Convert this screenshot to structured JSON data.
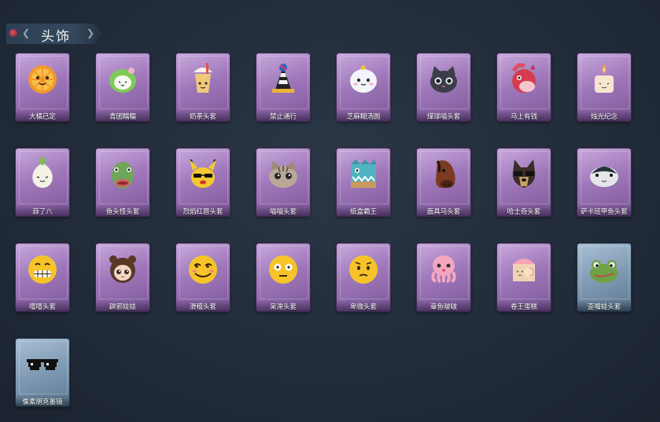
{
  "section": {
    "title": "头饰"
  },
  "items": [
    {
      "label": "大橘已定",
      "icon": "orange-icon",
      "rarity": "purple"
    },
    {
      "label": "青团糯糯",
      "icon": "green-rice-ball-icon",
      "rarity": "purple"
    },
    {
      "label": "奶茶头套",
      "icon": "milk-tea-icon",
      "rarity": "purple"
    },
    {
      "label": "禁止通行",
      "icon": "traffic-cone-icon",
      "rarity": "purple"
    },
    {
      "label": "芝麻糊汤圆",
      "icon": "rice-dumpling-icon",
      "rarity": "purple"
    },
    {
      "label": "煤球喵头套",
      "icon": "black-cat-icon",
      "rarity": "purple"
    },
    {
      "label": "马上有钱",
      "icon": "red-horse-icon",
      "rarity": "purple"
    },
    {
      "label": "烛光纪念",
      "icon": "candle-icon",
      "rarity": "purple"
    },
    {
      "label": "蒜了八",
      "icon": "garlic-icon",
      "rarity": "purple"
    },
    {
      "label": "鱼头怪头套",
      "icon": "fish-head-icon",
      "rarity": "purple"
    },
    {
      "label": "烈焰红唇头套",
      "icon": "yellow-mascot-icon",
      "rarity": "purple"
    },
    {
      "label": "喵喵头套",
      "icon": "tabby-cat-icon",
      "rarity": "purple"
    },
    {
      "label": "纸盒霸王",
      "icon": "box-dinosaur-icon",
      "rarity": "purple"
    },
    {
      "label": "面具马头套",
      "icon": "horse-mask-icon",
      "rarity": "purple"
    },
    {
      "label": "哈士奇头套",
      "icon": "dog-sunglasses-icon",
      "rarity": "purple"
    },
    {
      "label": "萨卡班甲鱼头套",
      "icon": "armored-fish-icon",
      "rarity": "purple"
    },
    {
      "label": "嘻嘻头套",
      "icon": "grin-emoji-icon",
      "rarity": "purple"
    },
    {
      "label": "辟邪娃娃",
      "icon": "doll-icon",
      "rarity": "purple"
    },
    {
      "label": "滑稽头套",
      "icon": "smirk-emoji-icon",
      "rarity": "purple"
    },
    {
      "label": "呆滞头套",
      "icon": "dazed-emoji-icon",
      "rarity": "purple"
    },
    {
      "label": "卑微头套",
      "icon": "humble-emoji-icon",
      "rarity": "purple"
    },
    {
      "label": "章鱼啵啵",
      "icon": "octopus-icon",
      "rarity": "purple"
    },
    {
      "label": "卷王蛋糕",
      "icon": "roll-cake-icon",
      "rarity": "purple"
    },
    {
      "label": "歪嘴蛙头套",
      "icon": "frog-icon",
      "rarity": "blue"
    },
    {
      "label": "像素朋克墨镜",
      "icon": "pixel-sunglasses-icon",
      "rarity": "blue"
    }
  ]
}
